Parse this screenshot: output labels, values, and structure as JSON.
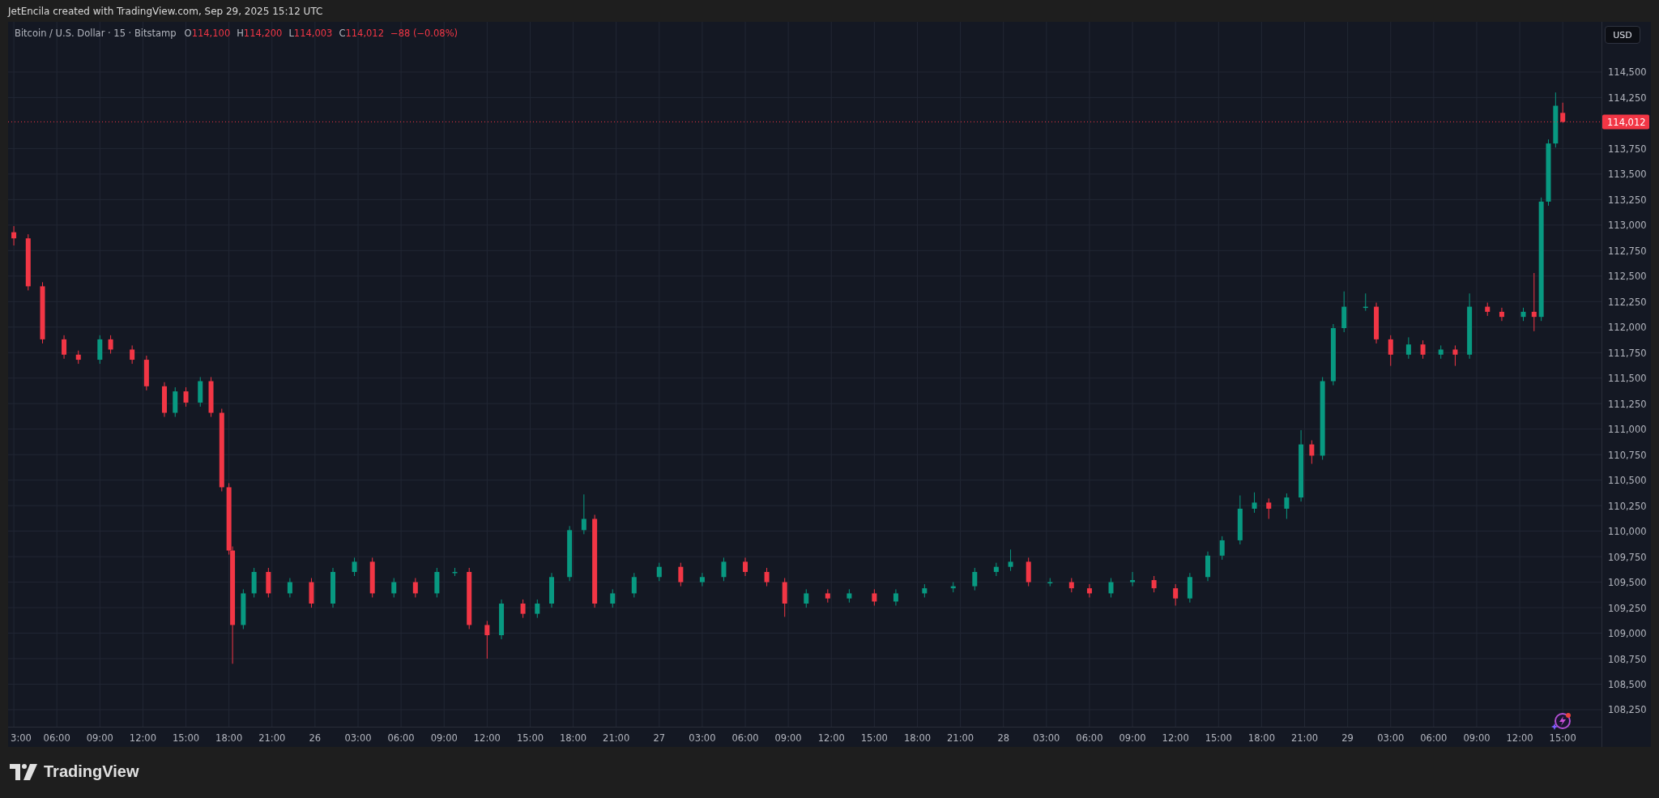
{
  "header": {
    "caption": "JetEncila created with TradingView.com, Sep 29, 2025 15:12 UTC"
  },
  "legend": {
    "symbol": "Bitcoin / U.S. Dollar · 15 · Bitstamp",
    "ohlc": [
      {
        "label": "O",
        "value": "114,100"
      },
      {
        "label": "H",
        "value": "114,200"
      },
      {
        "label": "L",
        "value": "114,003"
      },
      {
        "label": "C",
        "value": "114,012"
      }
    ],
    "change": "−88 (−0.08%)"
  },
  "price_axis": {
    "currency": "USD"
  },
  "chart": {
    "chart_data": {
      "type": "candlestick",
      "grid": true,
      "xlim": [
        "2025-09-25 02:36",
        "2025-09-29 17:42"
      ],
      "ylim": [
        108083,
        114992
      ],
      "x": [
        "2025-09-25 03:00",
        "2025-09-25 04:00",
        "2025-09-25 05:00",
        "2025-09-25 06:30",
        "2025-09-25 07:30",
        "2025-09-25 09:00",
        "2025-09-25 09:45",
        "2025-09-25 11:15",
        "2025-09-25 12:15",
        "2025-09-25 13:30",
        "2025-09-25 14:15",
        "2025-09-25 15:00",
        "2025-09-25 16:00",
        "2025-09-25 16:45",
        "2025-09-25 17:30",
        "2025-09-25 18:00",
        "2025-09-25 18:15",
        "2025-09-25 19:00",
        "2025-09-25 19:45",
        "2025-09-25 20:45",
        "2025-09-25 22:15",
        "2025-09-25 23:45",
        "2025-09-26 01:15",
        "2025-09-26 02:45",
        "2025-09-26 04:00",
        "2025-09-26 05:30",
        "2025-09-26 07:00",
        "2025-09-26 08:30",
        "2025-09-26 09:45",
        "2025-09-26 10:45",
        "2025-09-26 12:00",
        "2025-09-26 13:00",
        "2025-09-26 14:30",
        "2025-09-26 15:30",
        "2025-09-26 16:30",
        "2025-09-26 17:45",
        "2025-09-26 18:45",
        "2025-09-26 19:30",
        "2025-09-26 20:45",
        "2025-09-26 22:15",
        "2025-09-27 00:00",
        "2025-09-27 01:30",
        "2025-09-27 03:00",
        "2025-09-27 04:30",
        "2025-09-27 06:00",
        "2025-09-27 07:30",
        "2025-09-27 08:45",
        "2025-09-27 10:15",
        "2025-09-27 11:45",
        "2025-09-27 13:15",
        "2025-09-27 15:00",
        "2025-09-27 16:30",
        "2025-09-27 18:30",
        "2025-09-27 20:30",
        "2025-09-27 22:00",
        "2025-09-27 23:30",
        "2025-09-28 00:30",
        "2025-09-28 01:45",
        "2025-09-28 03:15",
        "2025-09-28 04:45",
        "2025-09-28 06:00",
        "2025-09-28 07:30",
        "2025-09-28 09:00",
        "2025-09-28 10:30",
        "2025-09-28 12:00",
        "2025-09-28 13:00",
        "2025-09-28 14:15",
        "2025-09-28 15:15",
        "2025-09-28 16:30",
        "2025-09-28 17:30",
        "2025-09-28 18:30",
        "2025-09-28 19:45",
        "2025-09-28 20:45",
        "2025-09-28 21:30",
        "2025-09-28 22:15",
        "2025-09-28 23:00",
        "2025-09-28 23:45",
        "2025-09-29 01:15",
        "2025-09-29 02:00",
        "2025-09-29 03:00",
        "2025-09-29 04:15",
        "2025-09-29 05:15",
        "2025-09-29 06:30",
        "2025-09-29 07:30",
        "2025-09-29 08:30",
        "2025-09-29 09:45",
        "2025-09-29 10:45",
        "2025-09-29 12:15",
        "2025-09-29 13:00",
        "2025-09-29 13:30",
        "2025-09-29 14:00",
        "2025-09-29 14:30",
        "2025-09-29 15:00"
      ],
      "ohlc": [
        [
          112930,
          112990,
          112800,
          112870
        ],
        [
          112870,
          112910,
          112360,
          112400
        ],
        [
          112400,
          112440,
          111840,
          111880
        ],
        [
          111880,
          111920,
          111690,
          111730
        ],
        [
          111730,
          111770,
          111640,
          111680
        ],
        [
          111680,
          111920,
          111640,
          111880
        ],
        [
          111880,
          111920,
          111740,
          111780
        ],
        [
          111780,
          111820,
          111640,
          111680
        ],
        [
          111680,
          111720,
          111380,
          111420
        ],
        [
          111420,
          111460,
          111120,
          111160
        ],
        [
          111160,
          111410,
          111120,
          111370
        ],
        [
          111370,
          111410,
          111220,
          111260
        ],
        [
          111260,
          111510,
          111220,
          111470
        ],
        [
          111470,
          111510,
          111120,
          111160
        ],
        [
          111160,
          111200,
          110390,
          110430
        ],
        [
          110430,
          110470,
          109770,
          109810
        ],
        [
          109810,
          109850,
          108700,
          109080
        ],
        [
          109080,
          109430,
          109040,
          109390
        ],
        [
          109390,
          109640,
          109350,
          109600
        ],
        [
          109600,
          109640,
          109350,
          109390
        ],
        [
          109390,
          109540,
          109350,
          109500
        ],
        [
          109500,
          109540,
          109250,
          109290
        ],
        [
          109290,
          109640,
          109250,
          109600
        ],
        [
          109600,
          109740,
          109560,
          109700
        ],
        [
          109700,
          109740,
          109350,
          109390
        ],
        [
          109390,
          109540,
          109350,
          109500
        ],
        [
          109500,
          109540,
          109350,
          109390
        ],
        [
          109390,
          109640,
          109350,
          109600
        ],
        [
          109600,
          109640,
          109560,
          109600
        ],
        [
          109600,
          109640,
          109040,
          109080
        ],
        [
          109080,
          109120,
          108750,
          108980
        ],
        [
          108980,
          109330,
          108940,
          109290
        ],
        [
          109290,
          109330,
          109150,
          109190
        ],
        [
          109190,
          109330,
          109150,
          109290
        ],
        [
          109290,
          109590,
          109250,
          109550
        ],
        [
          109550,
          110050,
          109510,
          110010
        ],
        [
          110010,
          110360,
          109970,
          110120
        ],
        [
          110120,
          110160,
          109250,
          109290
        ],
        [
          109290,
          109430,
          109250,
          109390
        ],
        [
          109390,
          109590,
          109350,
          109550
        ],
        [
          109550,
          109690,
          109510,
          109650
        ],
        [
          109650,
          109690,
          109460,
          109500
        ],
        [
          109500,
          109590,
          109460,
          109550
        ],
        [
          109550,
          109740,
          109510,
          109700
        ],
        [
          109700,
          109740,
          109560,
          109600
        ],
        [
          109600,
          109640,
          109460,
          109500
        ],
        [
          109500,
          109540,
          109160,
          109290
        ],
        [
          109290,
          109430,
          109250,
          109390
        ],
        [
          109390,
          109430,
          109300,
          109340
        ],
        [
          109340,
          109430,
          109300,
          109390
        ],
        [
          109390,
          109430,
          109270,
          109310
        ],
        [
          109310,
          109430,
          109270,
          109390
        ],
        [
          109390,
          109480,
          109350,
          109440
        ],
        [
          109440,
          109500,
          109400,
          109460
        ],
        [
          109460,
          109640,
          109420,
          109600
        ],
        [
          109600,
          109690,
          109560,
          109650
        ],
        [
          109650,
          109820,
          109610,
          109700
        ],
        [
          109700,
          109740,
          109460,
          109500
        ],
        [
          109500,
          109540,
          109460,
          109500
        ],
        [
          109500,
          109540,
          109400,
          109440
        ],
        [
          109440,
          109480,
          109350,
          109390
        ],
        [
          109390,
          109540,
          109350,
          109500
        ],
        [
          109500,
          109600,
          109460,
          109520
        ],
        [
          109520,
          109560,
          109400,
          109440
        ],
        [
          109440,
          109480,
          109270,
          109340
        ],
        [
          109340,
          109590,
          109300,
          109550
        ],
        [
          109550,
          109800,
          109510,
          109760
        ],
        [
          109760,
          109950,
          109720,
          109910
        ],
        [
          109910,
          110350,
          109870,
          110220
        ],
        [
          110220,
          110380,
          110180,
          110280
        ],
        [
          110280,
          110320,
          110120,
          110220
        ],
        [
          110220,
          110370,
          110120,
          110330
        ],
        [
          110330,
          110990,
          110290,
          110850
        ],
        [
          110850,
          110890,
          110660,
          110740
        ],
        [
          110740,
          111510,
          110700,
          111470
        ],
        [
          111470,
          112030,
          111430,
          111990
        ],
        [
          111990,
          112350,
          111950,
          112200
        ],
        [
          112200,
          112330,
          112160,
          112200
        ],
        [
          112200,
          112240,
          111840,
          111880
        ],
        [
          111880,
          111920,
          111620,
          111730
        ],
        [
          111730,
          111900,
          111690,
          111830
        ],
        [
          111830,
          111870,
          111690,
          111730
        ],
        [
          111730,
          111820,
          111690,
          111780
        ],
        [
          111780,
          111820,
          111620,
          111730
        ],
        [
          111730,
          112330,
          111690,
          112200
        ],
        [
          112200,
          112240,
          112110,
          112150
        ],
        [
          112150,
          112190,
          112060,
          112100
        ],
        [
          112100,
          112190,
          112060,
          112150
        ],
        [
          112150,
          112530,
          111960,
          112100
        ],
        [
          112100,
          113270,
          112060,
          113230
        ],
        [
          113230,
          113840,
          113190,
          113800
        ],
        [
          113800,
          114300,
          113760,
          114170
        ],
        [
          114100,
          114200,
          114003,
          114012
        ]
      ],
      "ref_lines": [
        {
          "axis": "y",
          "value": 114012,
          "color": "#f23645",
          "label": "114,012"
        }
      ],
      "xticks": [
        {
          "value": "2025-09-25 03:00",
          "label": "3:00"
        },
        {
          "value": "2025-09-25 06:00",
          "label": "06:00"
        },
        {
          "value": "2025-09-25 09:00",
          "label": "09:00"
        },
        {
          "value": "2025-09-25 12:00",
          "label": "12:00"
        },
        {
          "value": "2025-09-25 15:00",
          "label": "15:00"
        },
        {
          "value": "2025-09-25 18:00",
          "label": "18:00"
        },
        {
          "value": "2025-09-25 21:00",
          "label": "21:00"
        },
        {
          "value": "2025-09-26 00:00",
          "label": "26"
        },
        {
          "value": "2025-09-26 03:00",
          "label": "03:00"
        },
        {
          "value": "2025-09-26 06:00",
          "label": "06:00"
        },
        {
          "value": "2025-09-26 09:00",
          "label": "09:00"
        },
        {
          "value": "2025-09-26 12:00",
          "label": "12:00"
        },
        {
          "value": "2025-09-26 15:00",
          "label": "15:00"
        },
        {
          "value": "2025-09-26 18:00",
          "label": "18:00"
        },
        {
          "value": "2025-09-26 21:00",
          "label": "21:00"
        },
        {
          "value": "2025-09-27 00:00",
          "label": "27"
        },
        {
          "value": "2025-09-27 03:00",
          "label": "03:00"
        },
        {
          "value": "2025-09-27 06:00",
          "label": "06:00"
        },
        {
          "value": "2025-09-27 09:00",
          "label": "09:00"
        },
        {
          "value": "2025-09-27 12:00",
          "label": "12:00"
        },
        {
          "value": "2025-09-27 15:00",
          "label": "15:00"
        },
        {
          "value": "2025-09-27 18:00",
          "label": "18:00"
        },
        {
          "value": "2025-09-27 21:00",
          "label": "21:00"
        },
        {
          "value": "2025-09-28 00:00",
          "label": "28"
        },
        {
          "value": "2025-09-28 03:00",
          "label": "03:00"
        },
        {
          "value": "2025-09-28 06:00",
          "label": "06:00"
        },
        {
          "value": "2025-09-28 09:00",
          "label": "09:00"
        },
        {
          "value": "2025-09-28 12:00",
          "label": "12:00"
        },
        {
          "value": "2025-09-28 15:00",
          "label": "15:00"
        },
        {
          "value": "2025-09-28 18:00",
          "label": "18:00"
        },
        {
          "value": "2025-09-28 21:00",
          "label": "21:00"
        },
        {
          "value": "2025-09-29 00:00",
          "label": "29"
        },
        {
          "value": "2025-09-29 03:00",
          "label": "03:00"
        },
        {
          "value": "2025-09-29 06:00",
          "label": "06:00"
        },
        {
          "value": "2025-09-29 09:00",
          "label": "09:00"
        },
        {
          "value": "2025-09-29 12:00",
          "label": "12:00"
        },
        {
          "value": "2025-09-29 15:00",
          "label": "15:00"
        }
      ],
      "yticks": [
        {
          "value": 114500,
          "label": "114,500"
        },
        {
          "value": 114250,
          "label": "114,250"
        },
        {
          "value": 113750,
          "label": "113,750"
        },
        {
          "value": 113500,
          "label": "113,500"
        },
        {
          "value": 113250,
          "label": "113,250"
        },
        {
          "value": 113000,
          "label": "113,000"
        },
        {
          "value": 112750,
          "label": "112,750"
        },
        {
          "value": 112500,
          "label": "112,500"
        },
        {
          "value": 112250,
          "label": "112,250"
        },
        {
          "value": 112000,
          "label": "112,000"
        },
        {
          "value": 111750,
          "label": "111,750"
        },
        {
          "value": 111500,
          "label": "111,500"
        },
        {
          "value": 111250,
          "label": "111,250"
        },
        {
          "value": 111000,
          "label": "111,000"
        },
        {
          "value": 110750,
          "label": "110,750"
        },
        {
          "value": 110500,
          "label": "110,500"
        },
        {
          "value": 110250,
          "label": "110,250"
        },
        {
          "value": 110000,
          "label": "110,000"
        },
        {
          "value": 109750,
          "label": "109,750"
        },
        {
          "value": 109500,
          "label": "109,500"
        },
        {
          "value": 109250,
          "label": "109,250"
        },
        {
          "value": 109000,
          "label": "109,000"
        },
        {
          "value": 108750,
          "label": "108,750"
        },
        {
          "value": 108500,
          "label": "108,500"
        },
        {
          "value": 108250,
          "label": "108,250"
        }
      ]
    }
  },
  "footer": {
    "brand": "TradingView"
  }
}
